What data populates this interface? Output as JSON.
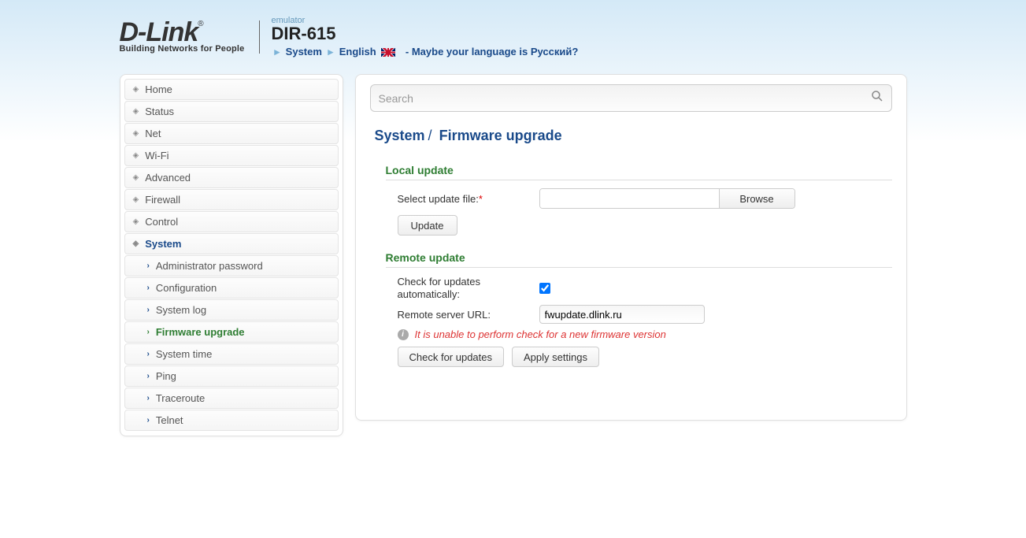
{
  "header": {
    "logo_main": "D-Link",
    "logo_sub": "Building Networks for People",
    "emulator": "emulator",
    "model": "DIR-615",
    "crumb_system": "System",
    "crumb_lang": "English",
    "lang_prompt": "- Maybe your language is Русский?"
  },
  "search": {
    "placeholder": "Search"
  },
  "sidebar": {
    "items": [
      {
        "label": "Home"
      },
      {
        "label": "Status"
      },
      {
        "label": "Net"
      },
      {
        "label": "Wi-Fi"
      },
      {
        "label": "Advanced"
      },
      {
        "label": "Firewall"
      },
      {
        "label": "Control"
      },
      {
        "label": "System",
        "active": true
      }
    ],
    "subitems": [
      {
        "label": "Administrator password"
      },
      {
        "label": "Configuration"
      },
      {
        "label": "System log"
      },
      {
        "label": "Firmware upgrade",
        "current": true
      },
      {
        "label": "System time"
      },
      {
        "label": "Ping"
      },
      {
        "label": "Traceroute"
      },
      {
        "label": "Telnet"
      }
    ]
  },
  "page": {
    "title_section": "System",
    "title_page": "Firmware upgrade"
  },
  "local": {
    "heading": "Local update",
    "select_label": "Select update file:",
    "browse": "Browse",
    "update_btn": "Update"
  },
  "remote": {
    "heading": "Remote update",
    "auto_label": "Check for updates automatically:",
    "auto_checked": true,
    "url_label": "Remote server URL:",
    "url_value": "fwupdate.dlink.ru",
    "warn": "It is unable to perform check for a new firmware version",
    "check_btn": "Check for updates",
    "apply_btn": "Apply settings"
  }
}
